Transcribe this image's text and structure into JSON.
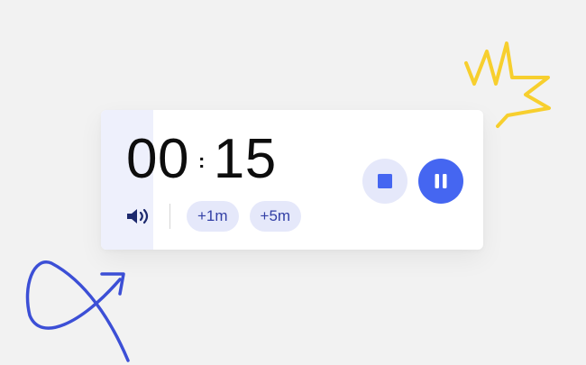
{
  "timer": {
    "minutes": "00",
    "separator": ":",
    "seconds": "15",
    "progress": 0.137
  },
  "controls": {
    "volume_icon": "speaker-volume-icon",
    "add_one_minute_label": "+1m",
    "add_five_minutes_label": "+5m",
    "stop_icon": "stop-icon",
    "pause_icon": "pause-icon"
  },
  "decorations": {
    "top_right": "yellow-crown-scribble",
    "bottom_left": "blue-loop-arrow-scribble"
  },
  "colors": {
    "background": "#f2f2f2",
    "card": "#ffffff",
    "progress": "#eef0fc",
    "accent": "#4566f1",
    "chip_background": "#e5e8fa",
    "chip_text": "#3340a6",
    "time_text": "#0d0d0d",
    "doodle_yellow": "#f7cf2e",
    "doodle_blue": "#3c4fd6"
  }
}
